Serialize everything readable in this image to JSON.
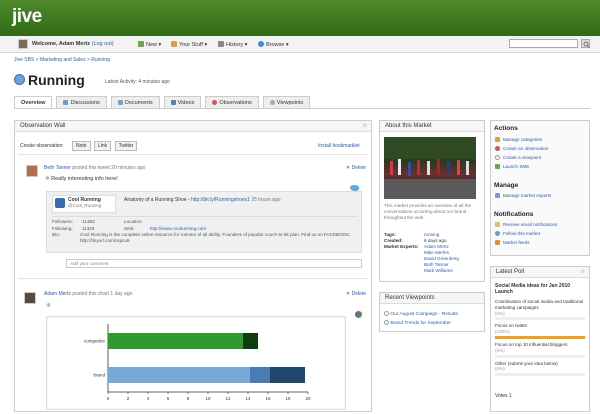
{
  "app": {
    "logo": "jive"
  },
  "userbar": {
    "welcome": "Welcome, Adam Mertz",
    "logout": "(Log out)"
  },
  "nav": [
    {
      "label": "New",
      "icon": "plus-icon"
    },
    {
      "label": "Your Stuff",
      "icon": "folder-icon"
    },
    {
      "label": "History",
      "icon": "history-icon"
    },
    {
      "label": "Browse",
      "icon": "globe-icon"
    }
  ],
  "breadcrumb": "Jive SBS > Marketing and Sales > Running",
  "page": {
    "title": "Running",
    "latest": "Latest Activity: 4 minutes ago"
  },
  "tabs": [
    "Overview",
    "Discussions",
    "Documents",
    "Videos",
    "Observations",
    "Viewpoints"
  ],
  "wall": {
    "title": "Observation Wall",
    "create_label": "Create observation:",
    "buttons": [
      "Note",
      "Link",
      "Twitter"
    ],
    "install": "Install bookmarklet",
    "post1": {
      "author": "Beth Tanner",
      "meta": "posted this tweet 20 minutes ago",
      "delete": "Delete",
      "text": "Really interesting info here!",
      "account_name": "Cool Running",
      "account_handle": "@Cool_Running",
      "tweet": "Anatomy of a Running Shoe -",
      "tweet_link": "http://bit.ly/Runningshoes1",
      "tweet_time": "25 hours ago",
      "followers_label": "Followers:",
      "followers": "11383",
      "following_label": "Following:",
      "following": "11326",
      "location_label": "Location:",
      "web_label": "Web:",
      "web": "http://www.coolrunning.com",
      "bio_label": "Bio:",
      "bio": "Cool Running is the complete online resource for runners of all ability. Founders of popular couch-to-5k plan. Find us on FACEBOOK: http://tinyurl.com/cspcu8",
      "comment_placeholder": "Add your comment"
    },
    "post2": {
      "author": "Adam Mertz",
      "meta": "posted this chart 1 day ago",
      "delete": "Delete"
    }
  },
  "chart_data": {
    "type": "bar",
    "categories": [
      "competitor",
      "brand"
    ],
    "series": [
      {
        "values": [
          15,
          20
        ]
      }
    ],
    "segments": [
      {
        "category": "competitor",
        "parts": [
          13.5,
          1.5
        ],
        "colors": [
          "#2f9a2f",
          "#0f3d0f"
        ]
      },
      {
        "category": "brand",
        "parts": [
          14.2,
          2.0,
          3.5
        ],
        "colors": [
          "#78a8d8",
          "#4a7cb4",
          "#23466e"
        ]
      }
    ],
    "xticks": [
      "0",
      "2",
      "4",
      "6",
      "8",
      "10",
      "12",
      "14",
      "16",
      "18",
      "20"
    ],
    "xlim": [
      0,
      20
    ],
    "orientation": "horizontal"
  },
  "about": {
    "title": "About this Market",
    "desc": "This market provides an overview of all the conversations occurring about our brand throughout the web.",
    "tags_label": "Tags:",
    "tags": "running",
    "created_label": "Created:",
    "created": "6 days ago",
    "experts_label": "Market Experts:",
    "experts": [
      "Adam Mertz",
      "Mike Merfes",
      "David Greenberg",
      "Beth Tanner",
      "Mark Williams"
    ]
  },
  "viewpoints": {
    "title": "Recent Viewpoints",
    "items": [
      "Our August Campaign - Results",
      "Brand Trends for September"
    ]
  },
  "actions": {
    "title": "Actions",
    "items": [
      "Manage categories",
      "Create an observation",
      "Create a viewpoint",
      "Launch SME"
    ]
  },
  "manage": {
    "title": "Manage",
    "items": [
      "Manage market experts"
    ]
  },
  "notifications": {
    "title": "Notifications",
    "items": [
      "Receive email notifications",
      "Follow this market",
      "Market feeds"
    ]
  },
  "poll": {
    "title": "Latest Poll",
    "question": "Social Media ideas for Jan 2010 Launch",
    "options": [
      {
        "label": "Coordination of social media and traditional marketing campaigns",
        "pct": "(0%)",
        "value": 0
      },
      {
        "label": "Focus on twitter",
        "pct": "(100%)",
        "value": 100
      },
      {
        "label": "Focus on top 10 influential bloggers",
        "pct": "(0%)",
        "value": 0
      },
      {
        "label": "Other (submit your idea below)",
        "pct": "(0%)",
        "value": 0
      }
    ],
    "votes": "Votes 1"
  },
  "colors": {
    "brand_green": "#3b7a1e",
    "link": "#2a5db0",
    "poll_bar": "#f0a020"
  }
}
